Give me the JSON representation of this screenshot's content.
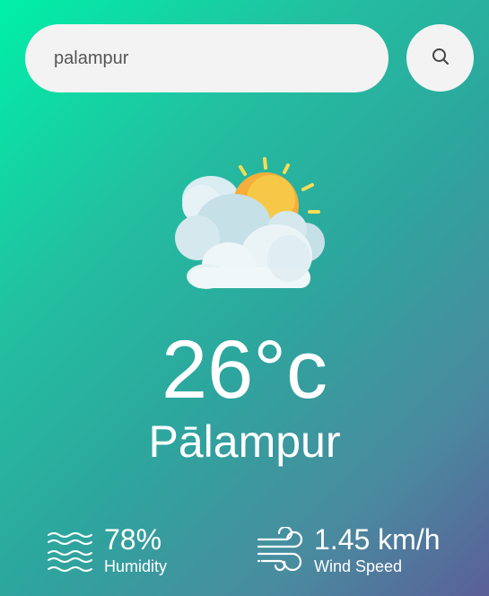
{
  "search": {
    "value": "palampur",
    "placeholder": "",
    "button_icon": "search-icon"
  },
  "weather": {
    "icon": "partly-cloudy-icon",
    "temperature": "26°c",
    "city": "Pālampur"
  },
  "details": {
    "humidity": {
      "icon": "humidity-waves-icon",
      "value": "78%",
      "label": "Humidity"
    },
    "wind": {
      "icon": "wind-icon",
      "value": "1.45 km/h",
      "label": "Wind Speed"
    }
  },
  "colors": {
    "gradient_start": "#00f0a8",
    "gradient_end": "#5a5f98",
    "input_bg": "#f3f3f3",
    "text": "#ffffff"
  }
}
